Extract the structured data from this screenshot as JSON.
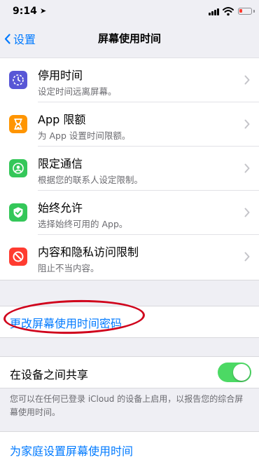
{
  "status_bar": {
    "time": "9:14",
    "location_arrow": "➤"
  },
  "nav": {
    "back_label": "设置",
    "title": "屏幕使用时间"
  },
  "items": [
    {
      "title": "停用时间",
      "subtitle": "设定时间远离屏幕。",
      "color": "#5856d6",
      "icon": "downtime-icon"
    },
    {
      "title": "App 限额",
      "subtitle": "为 App 设置时间限额。",
      "color": "#ff9500",
      "icon": "hourglass-icon"
    },
    {
      "title": "限定通信",
      "subtitle": "根据您的联系人设定限制。",
      "color": "#34c759",
      "icon": "contact-icon"
    },
    {
      "title": "始终允许",
      "subtitle": "选择始终可用的 App。",
      "color": "#34c759",
      "icon": "checkmark-icon"
    },
    {
      "title": "内容和隐私访问限制",
      "subtitle": "阻止不当内容。",
      "color": "#ff3b30",
      "icon": "restriction-icon"
    }
  ],
  "passcode": {
    "label": "更改屏幕使用时间密码",
    "highlight_color": "#d0021b"
  },
  "share": {
    "label": "在设备之间共享",
    "enabled": true,
    "description": "您可以在任何已登录 iCloud 的设备上启用，以报告您的综合屏幕使用时间。"
  },
  "family": {
    "label": "为家庭设置屏幕使用时间"
  },
  "colors": {
    "accent": "#007aff",
    "toggle_on": "#4cd964",
    "background": "#efeff4"
  }
}
